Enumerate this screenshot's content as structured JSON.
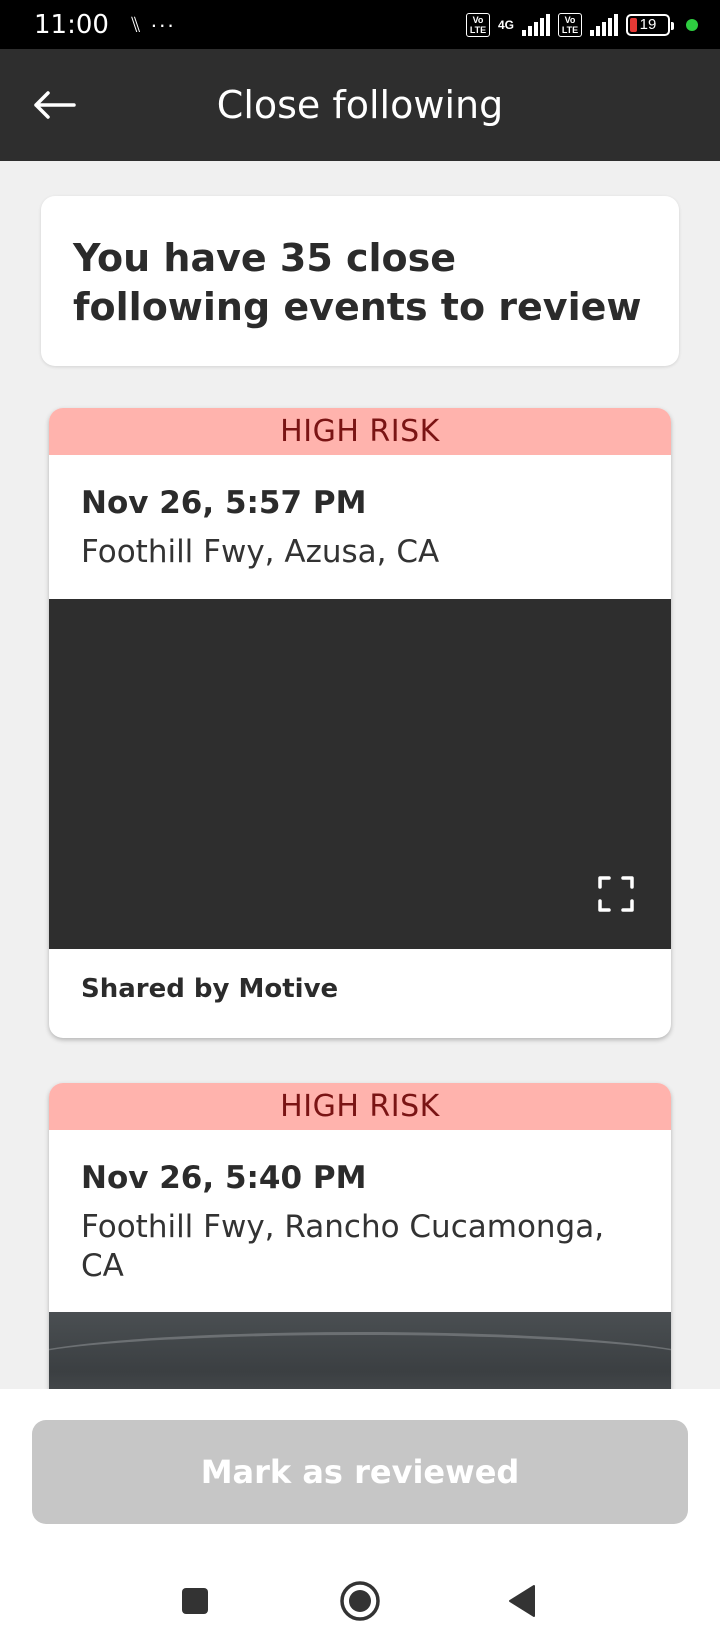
{
  "status_bar": {
    "time": "11:00",
    "extra_icons": "⑊ ···",
    "volte_label": "Vo LTE",
    "network_label": "4G",
    "battery_level": "19",
    "icons": [
      "signal-icon",
      "battery-icon",
      "recording-dot-icon"
    ]
  },
  "app_bar": {
    "title": "Close following",
    "back_icon": "arrow-left-icon"
  },
  "summary": {
    "text": "You have 35 close following events to review"
  },
  "events": [
    {
      "risk": "HIGH RISK",
      "date": "Nov 26, 5:57 PM",
      "location": "Foothill Fwy, Azusa, CA",
      "expand_icon": "fullscreen-icon",
      "shared_by": "Shared by Motive"
    },
    {
      "risk": "HIGH RISK",
      "date": "Nov 26, 5:40 PM",
      "location": "Foothill Fwy, Rancho Cucamonga, CA"
    }
  ],
  "actions": {
    "mark_reviewed": "Mark as reviewed"
  },
  "nav_bar": {
    "icons": [
      "recents-square-icon",
      "home-circle-icon",
      "back-triangle-icon"
    ]
  },
  "colors": {
    "app_bar": "#2e2e2e",
    "risk_banner": "#ffb3ad",
    "risk_text": "#7a1414",
    "button_disabled": "#c6c6c6"
  }
}
